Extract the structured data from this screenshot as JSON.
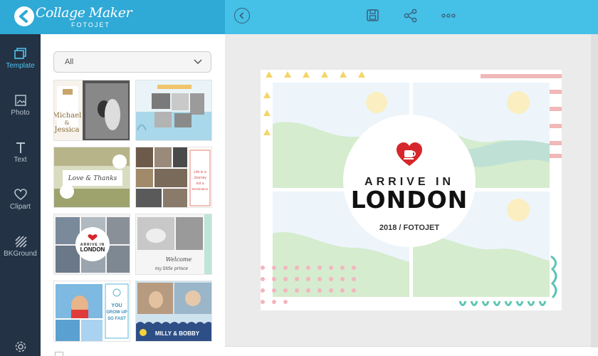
{
  "app": {
    "logo_title": "Collage Maker",
    "logo_sub": "FOTOJET"
  },
  "toolbar": {
    "icons": [
      "back-icon",
      "save-icon",
      "share-icon",
      "more-icon"
    ]
  },
  "nav": {
    "items": [
      {
        "label": "Template",
        "icon": "template-icon",
        "active": true
      },
      {
        "label": "Photo",
        "icon": "photo-icon",
        "active": false
      },
      {
        "label": "Text",
        "icon": "text-icon",
        "active": false
      },
      {
        "label": "Clipart",
        "icon": "heart-icon",
        "active": false
      },
      {
        "label": "BKGround",
        "icon": "background-icon",
        "active": false
      }
    ],
    "settings_icon": "gear-icon"
  },
  "panel": {
    "filter": {
      "selected": "All"
    },
    "thumbs": [
      {
        "texts": [
          "Michael",
          "&",
          "Jessica"
        ]
      },
      {
        "texts": []
      },
      {
        "texts": [
          "Love & Thanks"
        ]
      },
      {
        "texts": [
          "Life is a",
          "Journey",
          "not a",
          "Destination"
        ]
      },
      {
        "texts": [
          "ARRIVE IN",
          "LONDON"
        ]
      },
      {
        "texts": [
          "Welcome",
          "my little prince"
        ]
      },
      {
        "texts": [
          "YOU",
          "GROW UP",
          "SO FAST"
        ]
      },
      {
        "texts": [
          "MILLY & BOBBY"
        ]
      }
    ]
  },
  "canvas": {
    "headline_top": "ARRIVE IN",
    "headline_main": "LONDON",
    "caption": "2018 / FOTOJET"
  },
  "colors": {
    "topbar": "#45c0e6",
    "logo_bg": "#2fa9d6",
    "nav_bg": "#233244",
    "accent": "#4fc3ef",
    "heart": "#d6262b"
  }
}
